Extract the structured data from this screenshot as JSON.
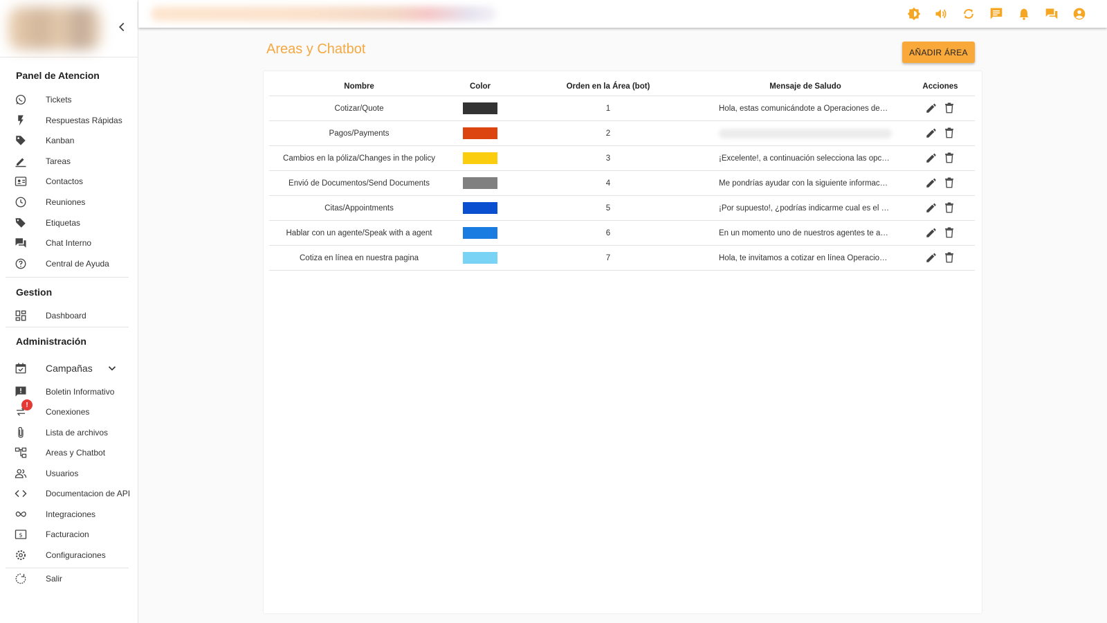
{
  "sidebar": {
    "section_panel": "Panel de Atencion",
    "section_gestion": "Gestion",
    "section_admin": "Administración",
    "panel_items": [
      {
        "label": "Tickets",
        "icon": "whatsapp-icon"
      },
      {
        "label": "Respuestas Rápidas",
        "icon": "flash-icon"
      },
      {
        "label": "Kanban",
        "icon": "tags-icon"
      },
      {
        "label": "Tareas",
        "icon": "pencil-icon"
      },
      {
        "label": "Contactos",
        "icon": "contact-card-icon"
      },
      {
        "label": "Reuniones",
        "icon": "clock-icon"
      },
      {
        "label": "Etiquetas",
        "icon": "tag-icon"
      },
      {
        "label": "Chat Interno",
        "icon": "forum-icon"
      },
      {
        "label": "Central de Ayuda",
        "icon": "help-circle-icon"
      }
    ],
    "gestion_items": [
      {
        "label": "Dashboard",
        "icon": "dashboard-icon"
      }
    ],
    "campaigns": {
      "label": "Campañas",
      "icon": "calendar-check-icon",
      "chevron": "chevron-down-icon"
    },
    "admin_items": [
      {
        "label": "Boletin Informativo",
        "icon": "announcement-icon"
      },
      {
        "label": "Conexiones",
        "icon": "sync-alt-icon",
        "badge": "!"
      },
      {
        "label": "Lista de archivos",
        "icon": "attach-icon"
      },
      {
        "label": "Areas y Chatbot",
        "icon": "account-tree-icon"
      },
      {
        "label": "Usuarios",
        "icon": "people-icon"
      },
      {
        "label": "Documentacion de API",
        "icon": "code-icon"
      },
      {
        "label": "Integraciones",
        "icon": "infinity-icon"
      },
      {
        "label": "Facturacion",
        "icon": "dollar-box-icon"
      },
      {
        "label": "Configuraciones",
        "icon": "settings-icon"
      },
      {
        "label": "Salir",
        "icon": "logout-icon"
      }
    ]
  },
  "topbar": {
    "icon_color": "#f5a623",
    "icons": [
      "brightness-icon",
      "volume-icon",
      "refresh-icon",
      "message-icon",
      "bell-icon",
      "chat-icon",
      "account-circle-icon"
    ]
  },
  "page": {
    "title": "Areas y Chatbot",
    "add_button": "AÑADIR ÁREA",
    "accent": "#f9a83a"
  },
  "table": {
    "headers": {
      "name": "Nombre",
      "color": "Color",
      "order": "Orden en la Área (bot)",
      "message": "Mensaje de Saludo",
      "actions": "Acciones"
    },
    "rows": [
      {
        "name": "Cotizar/Quote",
        "color": "#333333",
        "order": "1",
        "message": "Hola, estas comunicándote a Operaciones de…"
      },
      {
        "name": "Pagos/Payments",
        "color": "#dd4510",
        "order": "2",
        "message": null
      },
      {
        "name": "Cambios en la póliza/Changes in the policy",
        "color": "#fbcd0f",
        "order": "3",
        "message": "¡Excelente!, a continuación selecciona las opc…"
      },
      {
        "name": "Envió de Documentos/Send Documents",
        "color": "#808080",
        "order": "4",
        "message": "Me pondrías ayudar con la siguiente informac…"
      },
      {
        "name": "Citas/Appointments",
        "color": "#0a4fcf",
        "order": "5",
        "message": "¡Por supuesto!, ¿podrías indicarme cual es el …"
      },
      {
        "name": "Hablar con un agente/Speak with a agent",
        "color": "#1a7ce0",
        "order": "6",
        "message": "En un momento uno de nuestros agentes te a…"
      },
      {
        "name": "Cotiza en línea en nuestra pagina",
        "color": "#79d3f5",
        "order": "7",
        "message": "Hola, te invitamos a cotizar en línea Operacio…"
      }
    ]
  }
}
